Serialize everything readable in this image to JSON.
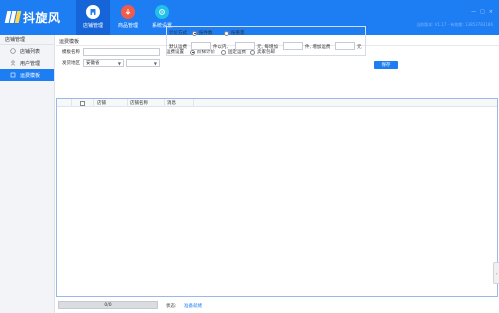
{
  "app": {
    "brand": "抖旋风",
    "info_text": "当前版本: V1.17 - 有效期: 13853783186",
    "top_marks": [
      "—",
      "□",
      "×"
    ]
  },
  "nav": {
    "tabs": [
      {
        "label": "店铺管理",
        "icon": "store-icon",
        "active": true
      },
      {
        "label": "商品管理",
        "icon": "product-icon",
        "active": false
      },
      {
        "label": "系统设置",
        "icon": "gear-icon",
        "active": false
      }
    ]
  },
  "sidebar": {
    "header": "店铺管理",
    "items": [
      {
        "label": "店铺列表",
        "icon": "store-list-icon"
      },
      {
        "label": "用户管理",
        "icon": "user-icon"
      },
      {
        "label": "运费模板",
        "icon": "template-icon"
      }
    ]
  },
  "main": {
    "title": "运费模板",
    "template_name_label": "模板名称",
    "template_name_value": "",
    "ship_from_label": "发货地区",
    "province_value": "安徽省",
    "city_value": "",
    "freight_settings_label": "运费设置",
    "freight_options": [
      {
        "label": "阶梯计价",
        "checked": true
      },
      {
        "label": "固定运费",
        "checked": false
      },
      {
        "label": "卖家包邮",
        "checked": false
      }
    ],
    "pricing_label": "计价方式",
    "pricing_options": [
      {
        "label": "按件数",
        "checked": true
      },
      {
        "label": "按重量",
        "checked": false
      }
    ],
    "default_freight_label": "默认运费",
    "within_label": "件以内,",
    "yuan_each_add_label": "元, 每增加",
    "piece_add_freight_label": "件, 增加运费",
    "yuan_label": "元",
    "inputs": {
      "first_count": "",
      "first_price": "",
      "add_count": "",
      "add_price": ""
    },
    "save_label": "保存"
  },
  "table": {
    "columns": [
      "",
      "店铺",
      "店铺名称",
      "消息"
    ]
  },
  "bottom": {
    "progress_text": "0/0",
    "status_label": "状态:",
    "status_value": "准备就绪"
  },
  "colors": {
    "accent": "#1d7df2"
  }
}
